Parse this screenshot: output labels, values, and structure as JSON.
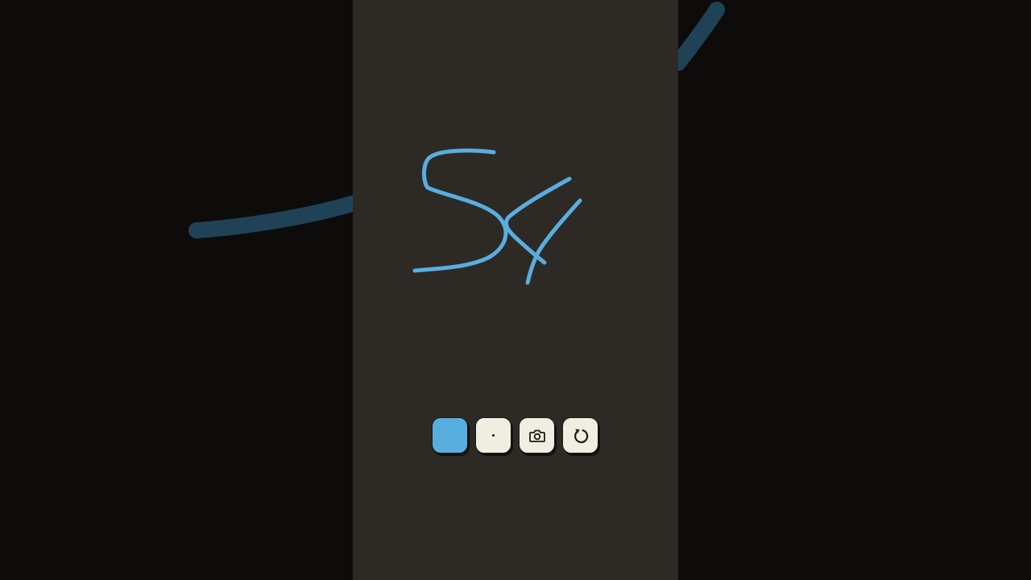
{
  "canvas": {
    "background_color": "#2d2a26",
    "stroke_color": "#59aee0",
    "handwriting_text": "S4"
  },
  "outer_background": {
    "color": "#0e0c0b",
    "blurred_stroke_color": "#1f4257"
  },
  "toolbar": {
    "items": [
      {
        "name": "color-picker-button",
        "icon": "color-swatch",
        "color": "#59aee0"
      },
      {
        "name": "brush-size-button",
        "icon": "dot-icon"
      },
      {
        "name": "camera-button",
        "icon": "camera-icon"
      },
      {
        "name": "undo-button",
        "icon": "undo-icon"
      }
    ],
    "button_color": "#eeeee1"
  }
}
